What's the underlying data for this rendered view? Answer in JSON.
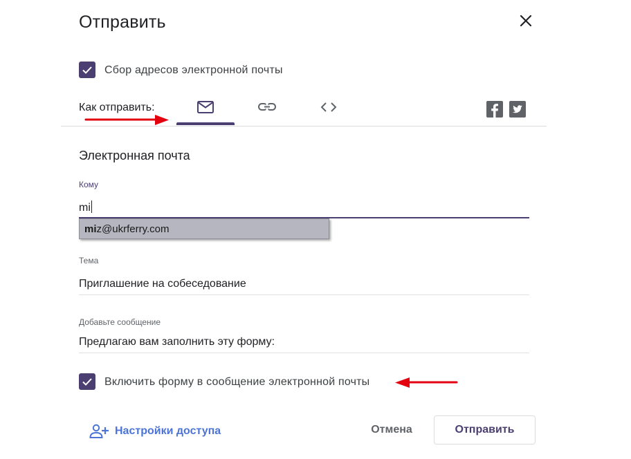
{
  "dialog": {
    "title": "Отправить"
  },
  "collect_emails": {
    "label": "Сбор адресов электронной почты",
    "checked": true
  },
  "send_via": {
    "label": "Как отправить:",
    "tabs": [
      {
        "icon": "email-icon",
        "selected": true
      },
      {
        "icon": "link-icon",
        "selected": false
      },
      {
        "icon": "embed-code-icon",
        "selected": false
      }
    ],
    "share": [
      "facebook-icon",
      "twitter-icon"
    ]
  },
  "email_section": {
    "title": "Электронная почта",
    "to": {
      "label": "Кому",
      "value": "mi"
    },
    "suggestion": {
      "match": "mi",
      "rest": "z@ukrferry.com"
    },
    "subject": {
      "label": "Тема",
      "value": "Приглашение на собеседование"
    },
    "message": {
      "label": "Добавьте сообщение",
      "value": "Предлагаю вам заполнить эту форму:"
    }
  },
  "include_form": {
    "label": "Включить форму в сообщение электронной почты",
    "checked": true
  },
  "footer": {
    "access_settings": "Настройки доступа",
    "cancel": "Отмена",
    "send": "Отправить"
  },
  "colors": {
    "accent": "#4b3f72",
    "link": "#4b74d6",
    "annotation_arrow": "#e3000f"
  }
}
